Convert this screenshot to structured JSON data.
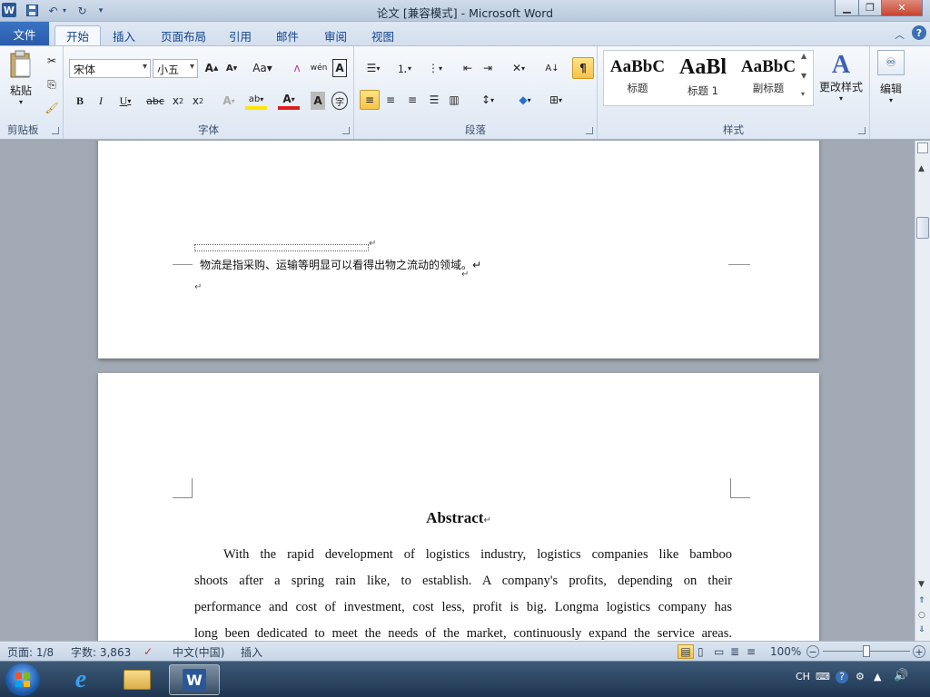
{
  "window": {
    "title": "论文 [兼容模式] - Microsoft Word",
    "app_icon": "W"
  },
  "tabs": [
    "文件",
    "开始",
    "插入",
    "页面布局",
    "引用",
    "邮件",
    "审阅",
    "视图"
  ],
  "active_tab": "开始",
  "ribbon": {
    "clipboard": {
      "paste_label": "粘贴",
      "group_label": "剪贴板"
    },
    "font": {
      "font_name": "宋体",
      "font_size": "小五",
      "group_label": "字体"
    },
    "paragraph": {
      "group_label": "段落"
    },
    "styles": {
      "items": [
        {
          "preview": "AaBbC",
          "name": "标题"
        },
        {
          "preview": "AaBl",
          "name": "标题 1"
        },
        {
          "preview": "AaBbC",
          "name": "副标题"
        }
      ],
      "change_styles_label": "更改样式",
      "group_label": "样式"
    },
    "editing": {
      "label": "编辑"
    }
  },
  "document": {
    "page1": {
      "footnote_text": "物流是指采购、运输等明显可以看得出物之流动的领域。↵",
      "para_mark": "↵",
      "small_mark": "↵"
    },
    "page2": {
      "heading": "Abstract",
      "heading_mark": "↵",
      "para_lines": [
        "With the rapid development of logistics industry, logistics companies like bamboo",
        "shoots after a spring rain like, to establish. A company's profits, depending on their",
        "performance and cost of investment, cost less, profit is big. Longma logistics company has",
        "long been dedicated to meet the needs of the market, continuously expand the service areas."
      ]
    }
  },
  "status_bar": {
    "page": "页面: 1/8",
    "words": "字数: 3,863",
    "language": "中文(中国)",
    "mode": "插入",
    "zoom": "100%"
  },
  "taskbar": {
    "tray_lang": "CH"
  },
  "colors": {
    "file_tab": "#2a5ba8",
    "ribbon_bg": "#dde7f3",
    "doc_bg": "#a1a9b4"
  }
}
